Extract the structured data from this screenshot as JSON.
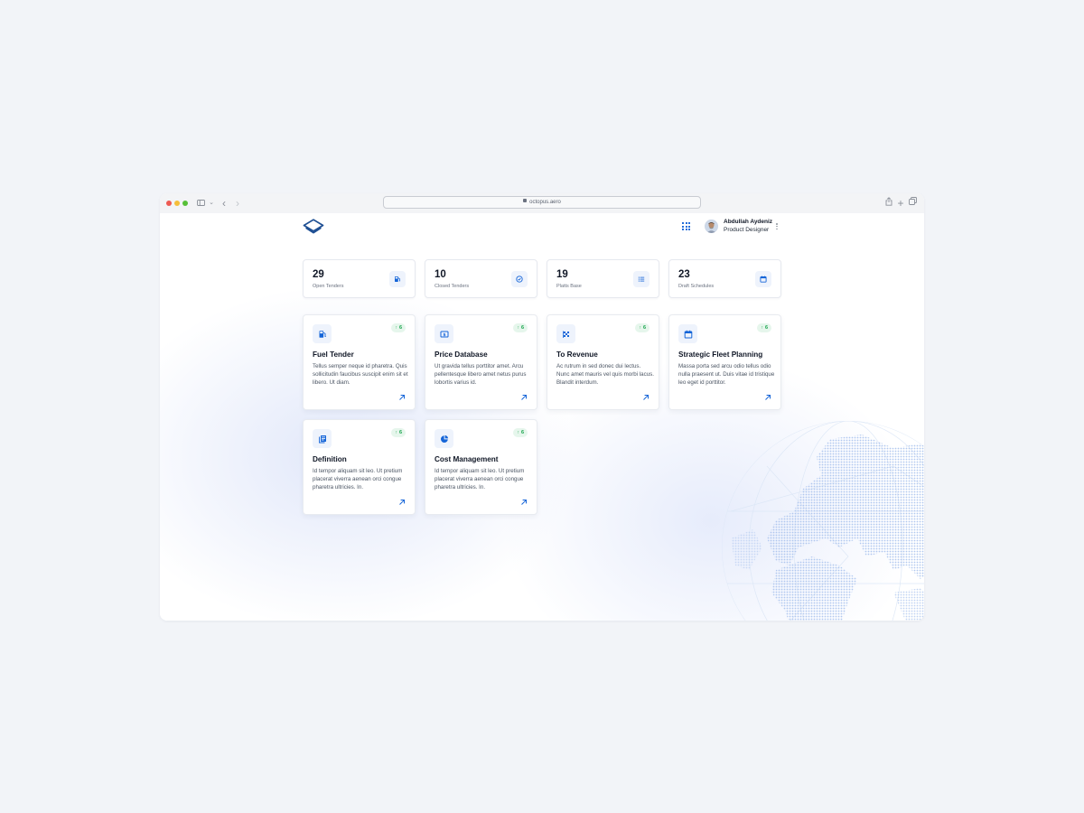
{
  "browser": {
    "url": "octopus.aero"
  },
  "header": {
    "user": {
      "name": "Abdullah Aydeniz",
      "role": "Product Designer"
    }
  },
  "stats": [
    {
      "value": "29",
      "label": "Open Tenders",
      "icon": "fuel-pump-icon"
    },
    {
      "value": "10",
      "label": "Closed Tenders",
      "icon": "check-circle-icon"
    },
    {
      "value": "19",
      "label": "Platts Base",
      "icon": "list-icon"
    },
    {
      "value": "23",
      "label": "Draft Schedules",
      "icon": "calendar-icon"
    }
  ],
  "modules": [
    {
      "title": "Fuel Tender",
      "description": "Tellus semper neque id pharetra. Quis sollicitudin faucibus suscipit enim sit et libero. Ut diam.",
      "badge": "6",
      "icon": "fuel-pump-icon"
    },
    {
      "title": "Price Database",
      "description": "Ut gravida tellus porttitor amet. Arcu pellentesque libero amet netus purus lobortis varius id.",
      "badge": "6",
      "icon": "dollar-icon"
    },
    {
      "title": "To Revenue",
      "description": "Ac rutrum in sed donec dui lectus. Nunc amet mauris vel quis morbi lacus. Blandit interdum.",
      "badge": "6",
      "icon": "checkered-flag-icon"
    },
    {
      "title": "Strategic Fleet Planning",
      "description": "Massa porta sed arcu odio tellus odio nulla praesent ut. Duis vitae id tristique leo eget id porttitor.",
      "badge": "6",
      "icon": "calendar-icon"
    },
    {
      "title": "Definition",
      "description": "Id tempor aliquam sit leo. Ut pretium placerat viverra aenean orci congue pharetra ultricies. In.",
      "badge": "6",
      "icon": "documents-icon"
    },
    {
      "title": "Cost Management",
      "description": "Id tempor aliquam sit leo. Ut pretium placerat viverra aenean orci congue pharetra ultricies. In.",
      "badge": "6",
      "icon": "pie-chart-icon"
    }
  ],
  "colors": {
    "accent": "#1565d8",
    "badge_bg": "#e6f6ec",
    "badge_text": "#16a34a",
    "page_bg": "#f2f4f8"
  }
}
